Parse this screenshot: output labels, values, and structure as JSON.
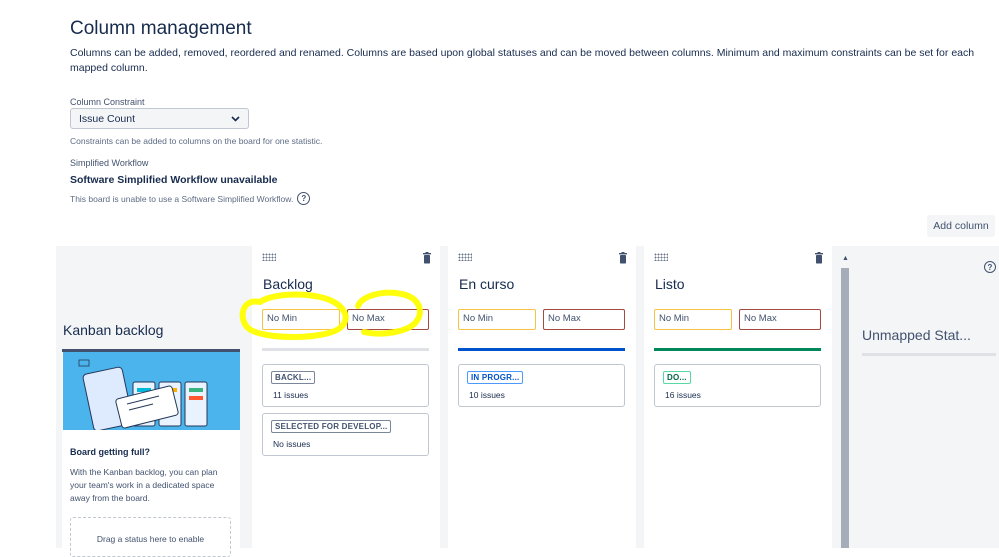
{
  "page": {
    "title": "Column management",
    "description": "Columns can be added, removed, reordered and renamed. Columns are based upon global statuses and can be moved between columns. Minimum and maximum constraints can be set for each mapped column."
  },
  "constraint": {
    "label": "Column Constraint",
    "selected": "Issue Count",
    "help": "Constraints can be added to columns on the board for one statistic."
  },
  "workflow": {
    "label": "Simplified Workflow",
    "title": "Software Simplified Workflow unavailable",
    "description": "This board is unable to use a Software Simplified Workflow.",
    "help_icon": "?"
  },
  "toolbar": {
    "add_column": "Add column"
  },
  "kanban_backlog": {
    "title": "Kanban backlog",
    "heading": "Board getting full?",
    "text": "With the Kanban backlog, you can plan your team's work in a dedicated space away from the board.",
    "dropzone": "Drag a status here to enable"
  },
  "columns": [
    {
      "name": "Backlog",
      "min_placeholder": "No Min",
      "max_placeholder": "No Max",
      "color": "#dfe1e6",
      "statuses": [
        {
          "label": "BACKL...",
          "count": "11 issues"
        },
        {
          "label": "SELECTED FOR DEVELOP...",
          "count": "No issues"
        }
      ]
    },
    {
      "name": "En curso",
      "min_placeholder": "No Min",
      "max_placeholder": "No Max",
      "color": "#0052cc",
      "statuses": [
        {
          "label": "IN PROGR...",
          "count": "10 issues"
        }
      ]
    },
    {
      "name": "Listo",
      "min_placeholder": "No Min",
      "max_placeholder": "No Max",
      "color": "#00875a",
      "statuses": [
        {
          "label": "DO...",
          "count": "16 issues"
        }
      ]
    }
  ],
  "unmapped": {
    "title": "Unmapped Stat..."
  },
  "board_help_icon": "?",
  "colors": {
    "accent_blue": "#0052cc",
    "done_green": "#00875a",
    "highlight_yellow": "#ffff00"
  }
}
